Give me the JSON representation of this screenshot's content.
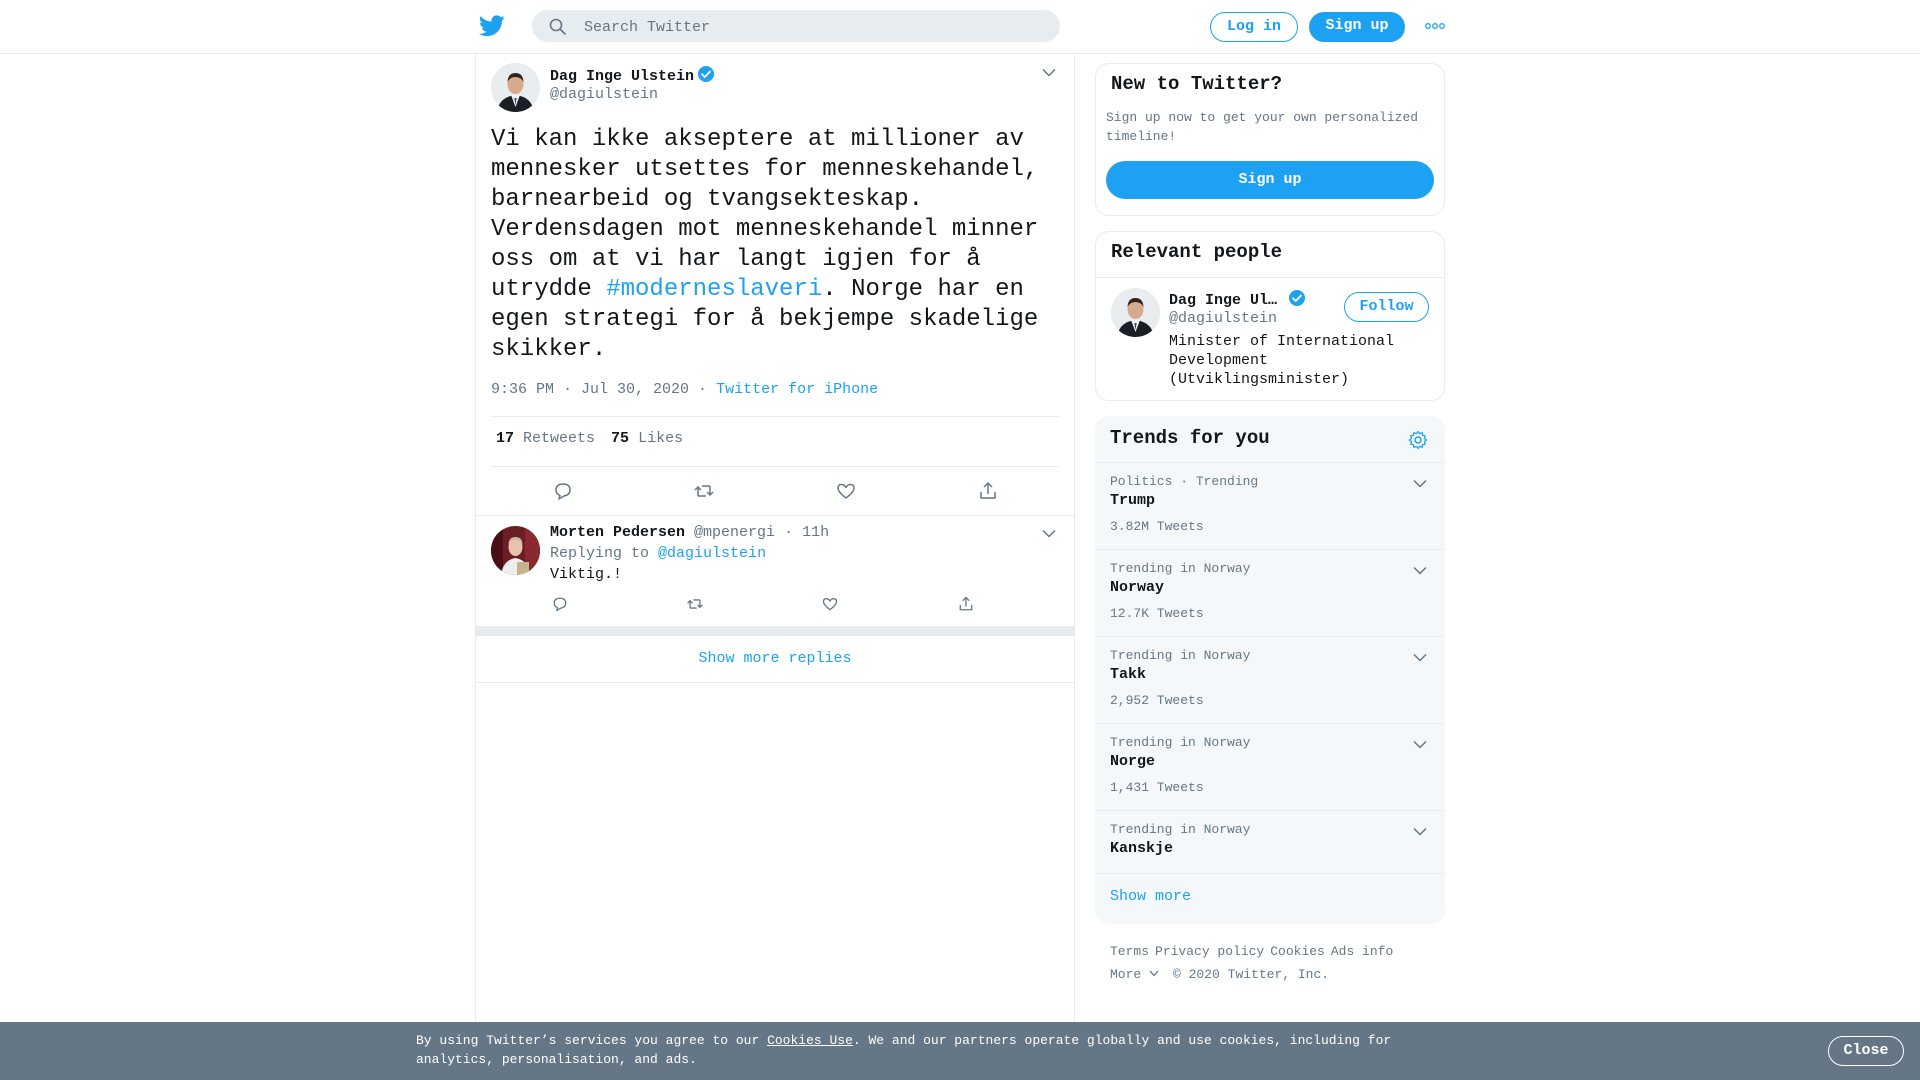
{
  "colors": {
    "brand": "#1da1f2",
    "text_primary": "#14171a",
    "text_secondary": "#657786",
    "border": "#e6ecf0",
    "banner_bg": "#657786"
  },
  "header": {
    "logo_icon": "twitter-bird-icon",
    "search_placeholder": "Search Twitter",
    "login_label": "Log in",
    "signup_label": "Sign up",
    "more_icon": "more-dots-icon"
  },
  "tweet": {
    "author_name": "Dag Inge Ulstein",
    "author_handle": "@dagiulstein",
    "verified": true,
    "text_before": "Vi kan ikke akseptere at millioner av mennesker utsettes for menneskehandel, barnearbeid og tvangsekteskap. Verdensdagen mot menneskehandel minner oss om at vi har langt igjen for å utrydde ",
    "hashtag": "#moderneslaveri",
    "text_after": ". Norge har en egen strategi for å bekjempe skadelige skikker.",
    "timestamp": "9:36 PM · Jul 30, 2020",
    "separator": " · ",
    "source": "Twitter for iPhone",
    "retweets_count": "17",
    "retweets_label": "Retweets",
    "likes_count": "75",
    "likes_label": "Likes"
  },
  "reply": {
    "author_name": "Morten Pedersen",
    "author_handle": "@mpenergi",
    "time": "· 11h",
    "replying_label": "Replying to",
    "replying_to": "@dagiulstein",
    "text": "Viktig.!",
    "show_more_label": "Show more replies"
  },
  "sidebar": {
    "new_to_twitter": {
      "title": "New to Twitter?",
      "description": "Sign up now to get your own personalized timeline!",
      "signup_label": "Sign up"
    },
    "relevant_people": {
      "title": "Relevant people",
      "name": "Dag Inge Ulstein",
      "handle": "@dagiulstein",
      "bio": "Minister of International Development (Utviklingsminister)",
      "follow_label": "Follow"
    },
    "trends": {
      "title": "Trends for you",
      "items": [
        {
          "context": "Politics · Trending",
          "name": "Trump",
          "count": "3.82M Tweets"
        },
        {
          "context": "Trending in Norway",
          "name": "Norway",
          "count": "12.7K Tweets"
        },
        {
          "context": "Trending in Norway",
          "name": "Takk",
          "count": "2,952 Tweets"
        },
        {
          "context": "Trending in Norway",
          "name": "Norge",
          "count": "1,431 Tweets"
        },
        {
          "context": "Trending in Norway",
          "name": "Kanskje",
          "count": ""
        }
      ],
      "show_more_label": "Show more"
    },
    "footer": {
      "links": [
        "Terms",
        "Privacy policy",
        "Cookies",
        "Ads info"
      ],
      "more_label": "More",
      "copyright": "© 2020 Twitter, Inc."
    }
  },
  "cookie_banner": {
    "text_before": "By using Twitter’s services you agree to our ",
    "link_label": "Cookies Use",
    "text_after": ". We and our partners operate globally and use cookies, including for analytics, personalisation, and ads.",
    "close_label": "Close"
  }
}
